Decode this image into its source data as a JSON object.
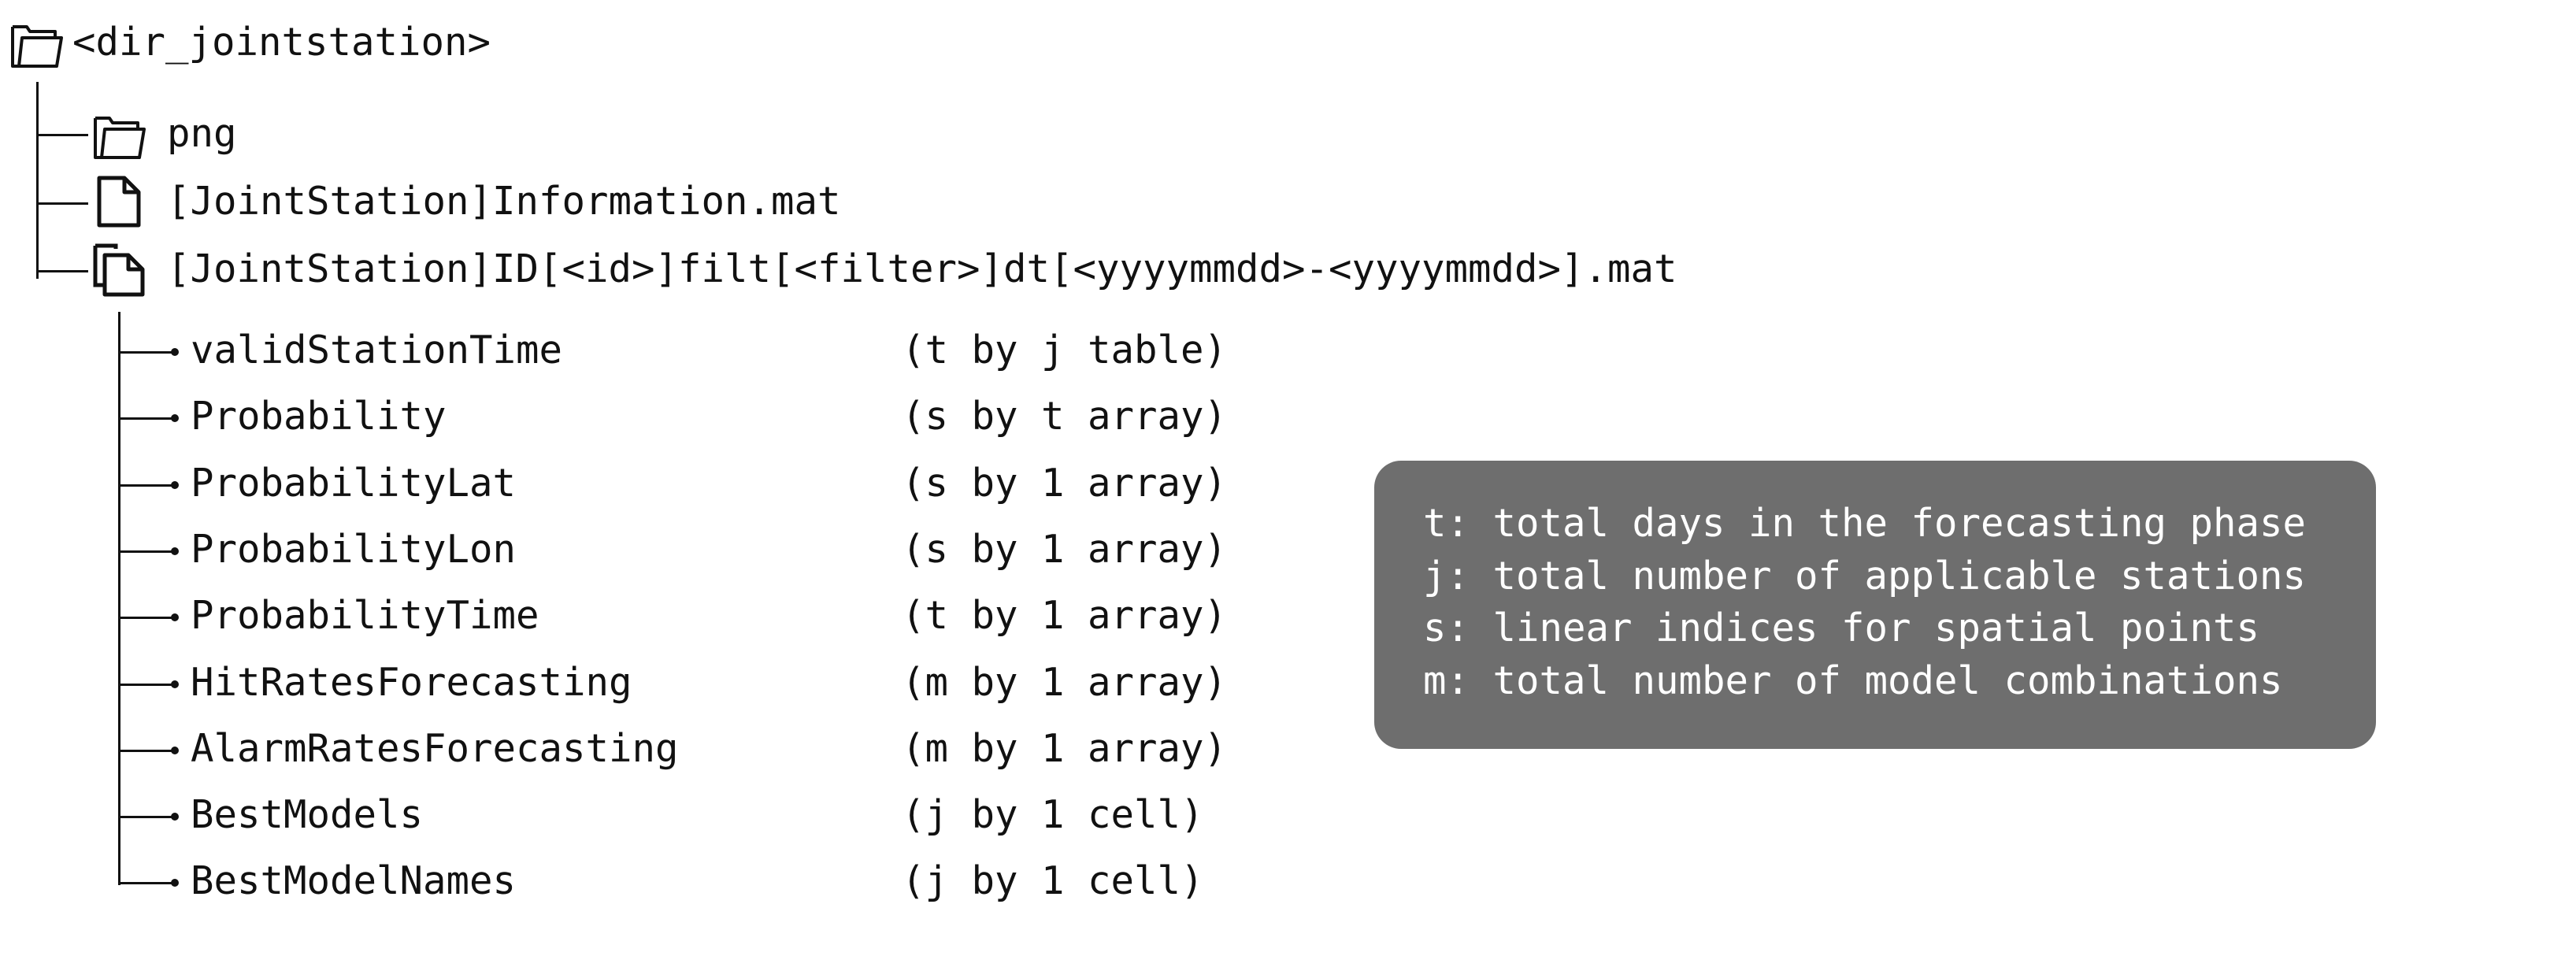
{
  "root": {
    "label": "<dir_jointstation>",
    "icon": "folder-open-icon"
  },
  "children": [
    {
      "label": "png",
      "icon": "folder-open-icon"
    },
    {
      "label": "[JointStation]Information.mat",
      "icon": "file-icon"
    },
    {
      "label": "[JointStation]ID[<id>]filt[<filter>]dt[<yyyymmdd>-<yyyymmdd>].mat",
      "icon": "files-stack-icon"
    }
  ],
  "fields": [
    {
      "name": "validStationTime",
      "shape": "(t by j table)"
    },
    {
      "name": "Probability",
      "shape": "(s by t array)"
    },
    {
      "name": "ProbabilityLat",
      "shape": "(s by 1 array)"
    },
    {
      "name": "ProbabilityLon",
      "shape": "(s by 1 array)"
    },
    {
      "name": "ProbabilityTime",
      "shape": "(t by 1 array)"
    },
    {
      "name": "HitRatesForecasting",
      "shape": "(m by 1 array)"
    },
    {
      "name": "AlarmRatesForecasting",
      "shape": "(m by 1 array)"
    },
    {
      "name": "BestModels",
      "shape": "(j by 1 cell)"
    },
    {
      "name": "BestModelNames",
      "shape": "(j by 1 cell)"
    }
  ],
  "legend": [
    "t: total days in the forecasting phase",
    "j: total number of applicable stations",
    "s: linear indices for spatial points",
    "m: total number of model combinations"
  ],
  "colors": {
    "text": "#111111",
    "legend_bg": "#6e6e6e",
    "legend_text": "#ffffff"
  }
}
